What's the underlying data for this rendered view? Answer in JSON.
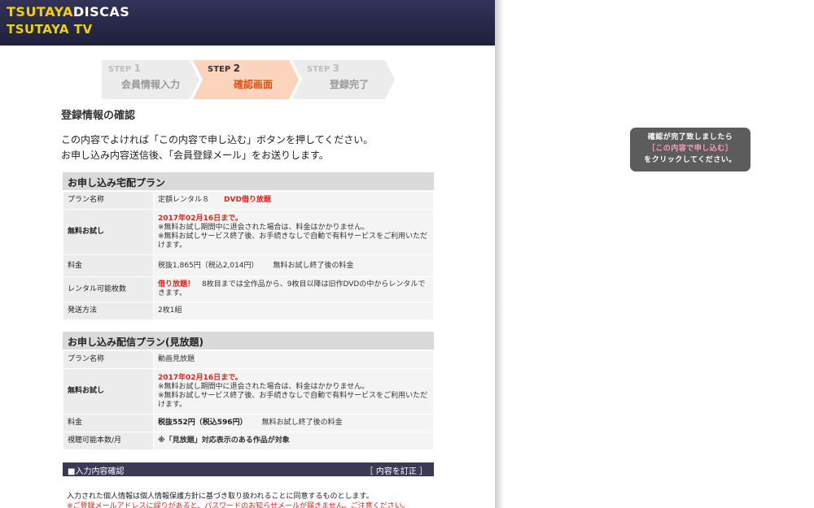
{
  "header": {
    "logo_top_yellow": "TSUTAYA",
    "logo_top_white": "DISCAS",
    "logo_bottom": "TSUTAYA TV"
  },
  "steps": [
    {
      "num_prefix": "STEP",
      "num": "1",
      "label": "会員情報入力",
      "active": false
    },
    {
      "num_prefix": "STEP",
      "num": "2",
      "label": "確認画面",
      "active": true
    },
    {
      "num_prefix": "STEP",
      "num": "3",
      "label": "登録完了",
      "active": false
    }
  ],
  "page_title": "登録情報の確認",
  "intro": {
    "line1": "この内容でよければ「この内容で申し込む」ボタンを押してください。",
    "line2": "お申し込み内容送信後、「会員登録メール」をお送りします。"
  },
  "delivery_plan": {
    "heading": "お申し込み宅配プラン",
    "plan_name_label": "プラン名称",
    "plan_name": "定額レンタル８",
    "plan_badge": "DVD借り放題",
    "trial_label": "無料お試し",
    "trial_until": "2017年02月16日まで。",
    "trial_note1": "※無料お試し期間中に退会された場合は、料金はかかりません。",
    "trial_note2": "※無料お試しサービス終了後、お手続きなしで自動で有料サービスをご利用いただけます。",
    "fee_label": "料金",
    "fee": "税抜1,865円（税込2,014円）",
    "fee_note": "無料お試し終了後の料金",
    "rental_label": "レンタル可能枚数",
    "rental_highlight": "借り放題！",
    "rental_text": "8枚目までは全作品から、9枚目以降は旧作DVDの中からレンタルできます。",
    "shipping_label": "発送方法",
    "shipping": "2枚1組"
  },
  "streaming_plan": {
    "heading": "お申し込み配信プラン(見放題)",
    "plan_name_label": "プラン名称",
    "plan_name": "動画見放題",
    "trial_label": "無料お試し",
    "trial_until": "2017年02月16日まで。",
    "trial_note1": "※無料お試し期間中に退会された場合は、料金はかかりません。",
    "trial_note2": "※無料お試しサービス終了後、お手続きなしで自動で有料サービスをご利用いただけます。",
    "fee_label": "料金",
    "fee": "税抜552円（税込596円）",
    "fee_note": "無料お試し終了後の料金",
    "view_label": "視聴可能本数/月",
    "view_value": "※「見放題」対応表示のある作品が対象"
  },
  "input_confirm": {
    "bar_label": "■入力内容確認",
    "fix_link": "［ 内容を訂正 ］"
  },
  "footer": {
    "agree": "入力された個人情報は個人情報保護方針に基づき取り扱われることに同意するものとします。",
    "warn": "※ご登録メールアドレスに誤りがあると、パスワードのお知らせメールが届きません。ご注意ください。"
  },
  "tooltip": {
    "line1": "確認が完了致しましたら",
    "line2": "［この内容で申し込む］",
    "line3": "をクリックしてください。"
  },
  "colors": {
    "header_bg": "#1f1f3d",
    "logo_yellow": "#f2d200",
    "active_step": "#fcd4be",
    "active_step_text": "#e2520f",
    "red_text": "#e1261c",
    "tooltip_bg": "#5c5c5c",
    "tooltip_highlight": "#ff9fb8"
  }
}
